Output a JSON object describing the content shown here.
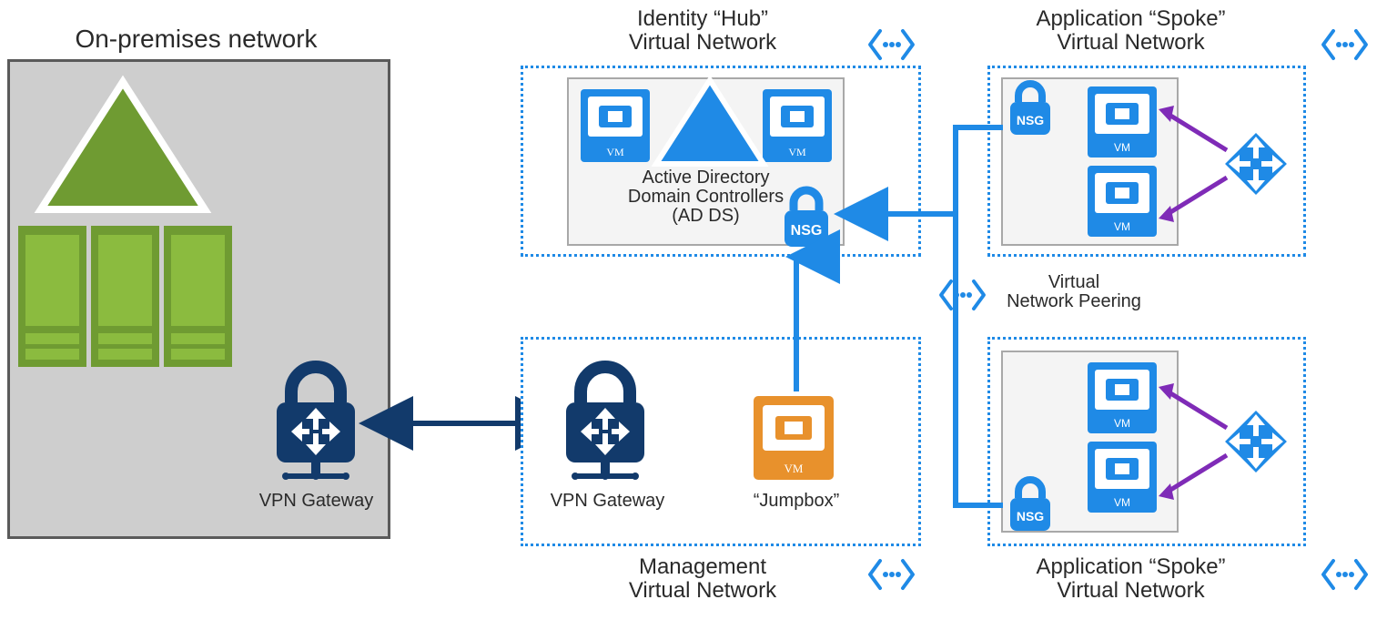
{
  "onprem": {
    "title": "On-premises network",
    "vpn": "VPN Gateway"
  },
  "hub": {
    "title_l1": "Identity “Hub”",
    "title_l2": "Virtual Network",
    "adds_l1": "Active Directory",
    "adds_l2": "Domain Controllers",
    "adds_l3": "(AD DS)"
  },
  "mgmt": {
    "title_l1": "Management",
    "title_l2": "Virtual Network",
    "vpn": "VPN Gateway",
    "jump": "“Jumpbox”"
  },
  "spoke1": {
    "title_l1": "Application “Spoke”",
    "title_l2": "Virtual Network"
  },
  "spoke2": {
    "title_l1": "Application “Spoke”",
    "title_l2": "Virtual Network"
  },
  "peering": {
    "l1": "Virtual",
    "l2": "Network Peering"
  },
  "nsg": "NSG",
  "vm": "VM"
}
